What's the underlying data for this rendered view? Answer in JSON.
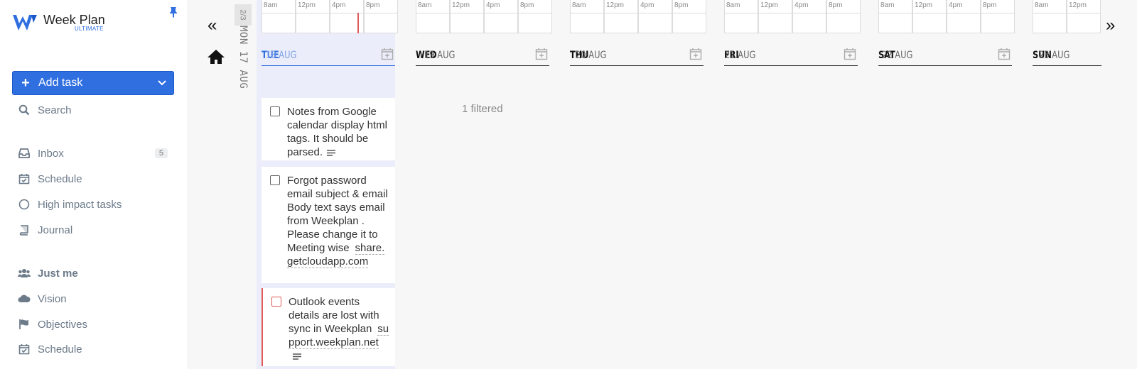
{
  "sidebar": {
    "brand_name": "Week Plan",
    "brand_tier": "ULTIMATE",
    "add_task_label": "Add task",
    "search_label": "Search",
    "inbox_label": "Inbox",
    "inbox_count": "5",
    "schedule_label": "Schedule",
    "high_impact_label": "High impact tasks",
    "journal_label": "Journal",
    "team_label": "Just me",
    "vision_label": "Vision",
    "objectives_label": "Objectives",
    "team_schedule_label": "Schedule"
  },
  "monday": {
    "count": "2/3",
    "label": "MON 17 AUG"
  },
  "timeline_labels": [
    "8am",
    "12pm",
    "4pm",
    "8pm"
  ],
  "days": [
    {
      "name": "TUE",
      "date": "18 AUG"
    },
    {
      "name": "WED",
      "date": "19 AUG"
    },
    {
      "name": "THU",
      "date": "20 AUG"
    },
    {
      "name": "FRI",
      "date": "21 AUG"
    },
    {
      "name": "SAT",
      "date": "22 AUG"
    },
    {
      "name": "SUN",
      "date": "23 AUG"
    }
  ],
  "filtered_text": "1 filtered",
  "tasks": [
    {
      "text": "Notes from Google calendar display html tags. It should be parsed."
    },
    {
      "text": "Forgot password email subject & email Body text says email from Weekplan . Please change it to Meeting wise",
      "link": "share.getcloudapp.com"
    },
    {
      "text": "Outlook events details are lost with sync in Weekplan",
      "link": "support.weekplan.net"
    }
  ],
  "colors": {
    "accent": "#2f6fe0",
    "today_bg": "#ecedfa",
    "overdue": "#e05a5a"
  }
}
